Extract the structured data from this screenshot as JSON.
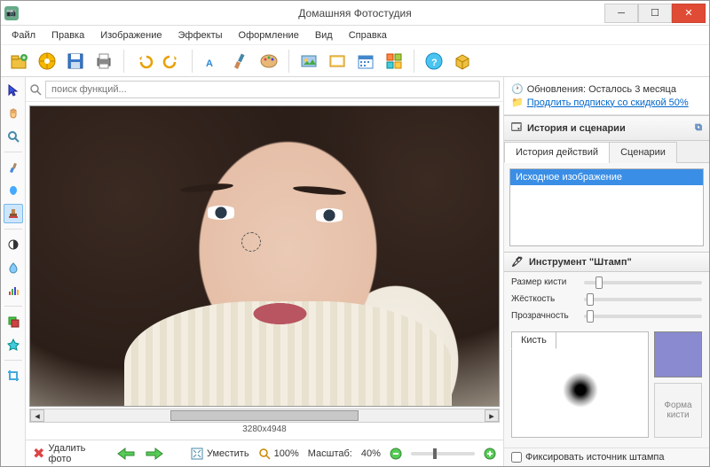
{
  "window": {
    "title": "Домашняя Фотостудия"
  },
  "menu": [
    "Файл",
    "Правка",
    "Изображение",
    "Эффекты",
    "Оформление",
    "Вид",
    "Справка"
  ],
  "search": {
    "placeholder": "поиск функций..."
  },
  "canvas": {
    "dims": "3280x4948"
  },
  "bottombar": {
    "delete": "Удалить фото",
    "fit": "Уместить",
    "zoom100": "100%",
    "scale_label": "Масштаб:",
    "scale_value": "40%"
  },
  "info": {
    "updates": "Обновления: Осталось  3 месяца",
    "extend": "Продлить подписку со скидкой 50%"
  },
  "history_panel": {
    "title": "История и сценарии",
    "tabs": {
      "history": "История действий",
      "scenarios": "Сценарии"
    },
    "items": [
      "Исходное изображение"
    ]
  },
  "tool_panel": {
    "title": "Инструмент \"Штамп\"",
    "size": "Размер кисти",
    "hardness": "Жёсткость",
    "opacity": "Прозрачность",
    "brush_tab": "Кисть",
    "shape_btn": "Форма кисти",
    "fix_source": "Фиксировать источник штампа"
  },
  "colors": {
    "brush": "#8a8ad0"
  }
}
